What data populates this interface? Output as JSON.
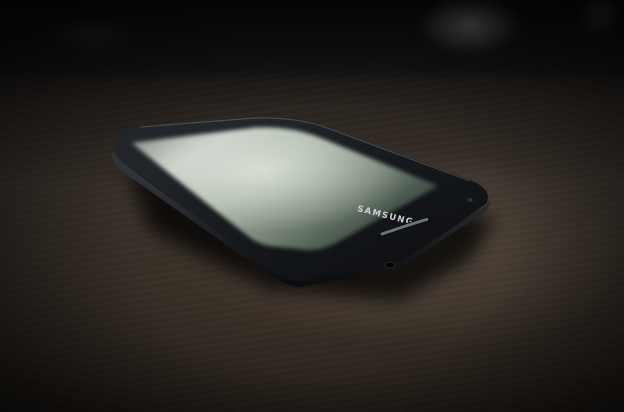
{
  "photo": {
    "brand_logo": "SAMSUNG",
    "colors": {
      "phone_body": "#15181c",
      "screen_glow": "#a9b6a8",
      "table_wood": "#3a322b",
      "background": "#0d0d0f"
    }
  }
}
